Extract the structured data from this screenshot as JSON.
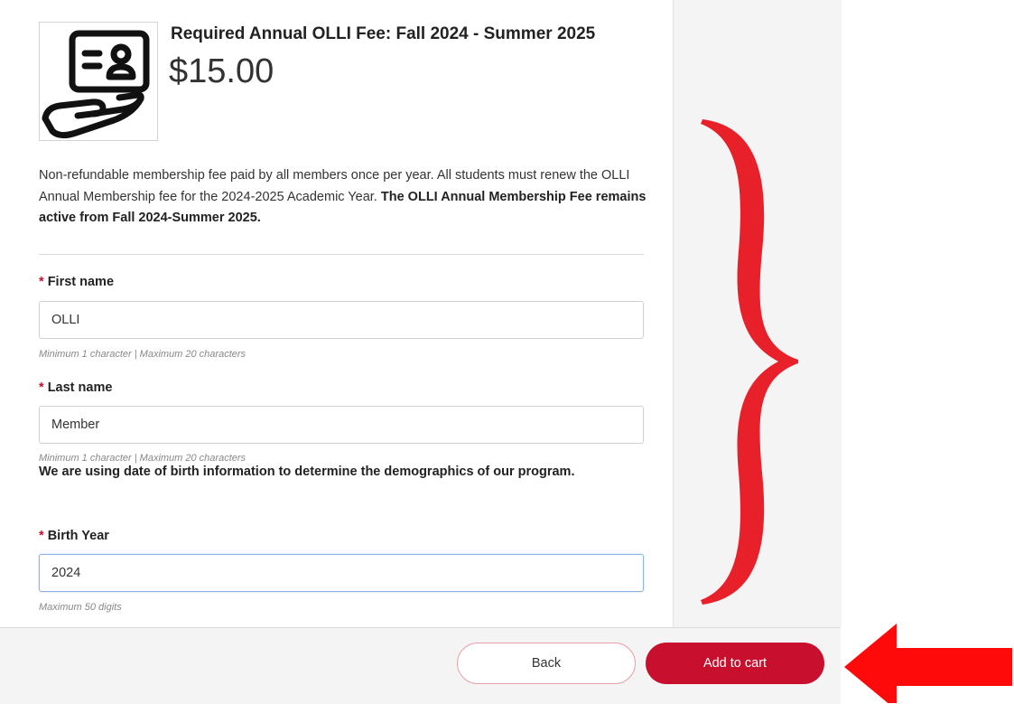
{
  "product": {
    "title": "Required Annual OLLI Fee: Fall 2024 - Summer 2025",
    "price": "$15.00",
    "icon": "membership-card-hand-icon",
    "description_plain": "Non-refundable membership fee paid by all members once per year. All students must renew the OLLI Annual Membership fee for the 2024-2025 Academic Year.",
    "description_bold": "The OLLI Annual Membership Fee remains active from Fall 2024-Summer 2025."
  },
  "form": {
    "required_marker": "*",
    "first_name": {
      "label": "First name",
      "value": "OLLI",
      "hint": "Minimum 1 character | Maximum 20 characters"
    },
    "last_name": {
      "label": "Last name",
      "value": "Member",
      "hint": "Minimum 1 character | Maximum 20 characters"
    },
    "demographics_note": "We are using date of birth information to determine the demographics of our program.",
    "birth_year": {
      "label": "Birth Year",
      "value": "2024",
      "hint": "Maximum 50 digits"
    }
  },
  "footer": {
    "back_label": "Back",
    "add_to_cart_label": "Add to cart"
  },
  "colors": {
    "accent": "#c8102e",
    "annotation": "#e8202a",
    "panel_bg": "#f4f4f4"
  },
  "annotations": {
    "brace": "curly-brace-annotation",
    "arrow": "left-arrow-annotation"
  }
}
